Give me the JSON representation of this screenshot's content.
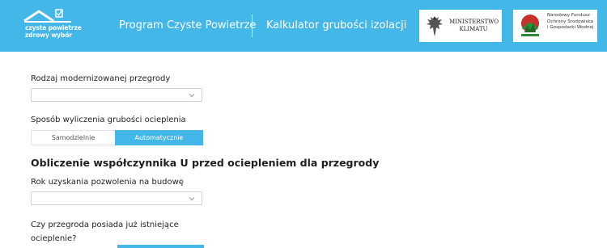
{
  "header": {
    "logo_line1": "czyste powietrze",
    "logo_line2": "zdrowy wybór",
    "program_title": "Program Czyste Powietrze",
    "calculator_title": "Kalkulator grubości izolacji",
    "ministry_line1": "MINISTERSTWO",
    "ministry_line2": "KLIMATU",
    "fund_line1": "Narodowy Fundusz",
    "fund_line2": "Ochrony Środowiska",
    "fund_line3": "i Gospodarki Wodnej"
  },
  "form": {
    "partition_label": "Rodzaj modernizowanej przegrody",
    "partition_value": "",
    "method_label": "Sposób wyliczenia grubości ocieplenia",
    "method_options": [
      "Samodzielnie",
      "Automatycznie"
    ],
    "method_selected": "Automatycznie",
    "section_title": "Obliczenie współczynnika U przed ociepleniem dla przegrody",
    "year_label": "Rok uzyskania pozwolenia na budowę",
    "year_value": "",
    "existing_insulation_question": "Czy przegroda posiada już istniejące ocieplenie?"
  },
  "colors": {
    "brand_blue": "#43b7e8",
    "text": "#222222",
    "border": "#cfd3d6"
  },
  "icons": [
    "house-logo-icon",
    "eagle-emblem-icon",
    "fund-logo-icon",
    "chevron-down-icon"
  ]
}
